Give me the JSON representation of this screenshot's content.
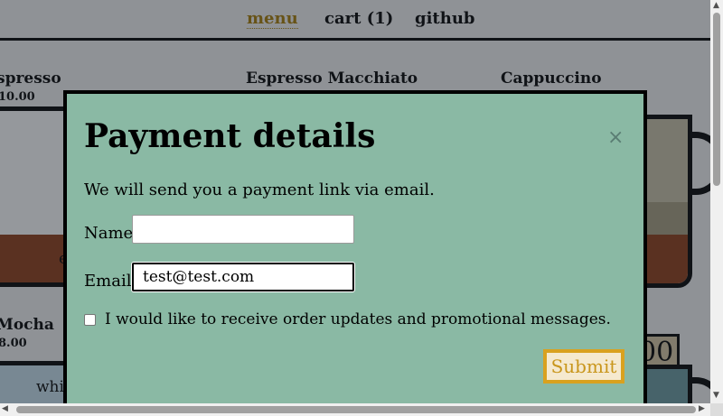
{
  "nav": {
    "menu": "menu",
    "cart": "cart (1)",
    "github": "github"
  },
  "products": [
    {
      "name": "spresso",
      "price": "10.00"
    },
    {
      "name": "Espresso Macchiato"
    },
    {
      "name": "Cappuccino"
    },
    {
      "name": "Mocha",
      "price": "8.00"
    }
  ],
  "background_fragments": {
    "cup1_text": "e",
    "whi": "whi",
    "price_box": "00"
  },
  "modal": {
    "title": "Payment details",
    "close_glyph": "×",
    "description": "We will send you a payment link via email.",
    "name_label": "Name",
    "name_value": "",
    "email_label": "Email",
    "email_value": "test@test.com",
    "checkbox_label": "I would like to receive order updates and promotional messages.",
    "submit_label": "Submit"
  },
  "colors": {
    "modal_bg": "#8ab9a4",
    "accent": "#d9a11f",
    "active_link": "#a87b00"
  }
}
